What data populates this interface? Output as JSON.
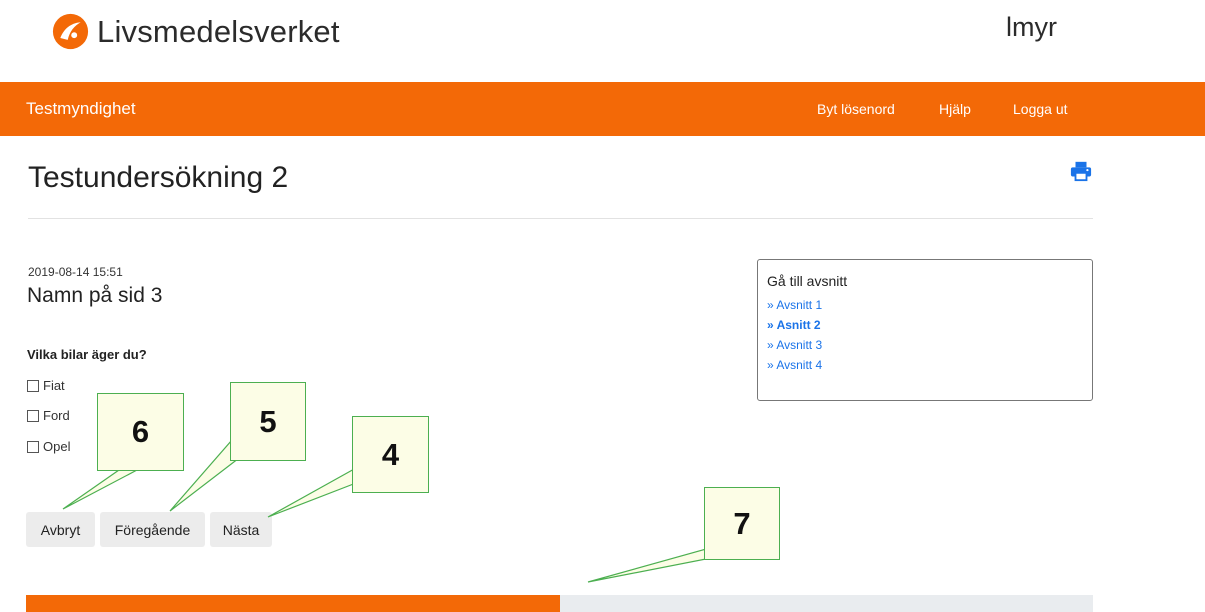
{
  "header": {
    "logo_text": "Livsmedelsverket",
    "user_name": "lmyr"
  },
  "navbar": {
    "brand": "Testmyndighet",
    "links": [
      "Byt lösenord",
      "Hjälp",
      "Logga ut"
    ]
  },
  "page": {
    "title": "Testundersökning 2",
    "timestamp": "2019-08-14 15:51",
    "section_name": "Namn på sid 3",
    "question": "Vilka bilar äger du?",
    "options": [
      "Fiat",
      "Ford",
      "Opel"
    ]
  },
  "buttons": {
    "cancel": "Avbryt",
    "previous": "Föregående",
    "next": "Nästa"
  },
  "section_nav": {
    "title": "Gå till avsnitt",
    "items": [
      "» Avsnitt 1",
      "» Asnitt 2",
      "» Avsnitt 3",
      "» Avsnitt 4"
    ],
    "current_index": 1
  },
  "progress": {
    "fraction": 0.5
  },
  "callouts": [
    "6",
    "5",
    "4",
    "7"
  ],
  "colors": {
    "brand_orange": "#f36907",
    "link_blue": "#1a73e8",
    "callout_border": "#4caf50",
    "callout_fill": "#fcfde6"
  },
  "icons": {
    "logo": "livsmedelsverket-logo-icon",
    "print": "print-icon"
  }
}
